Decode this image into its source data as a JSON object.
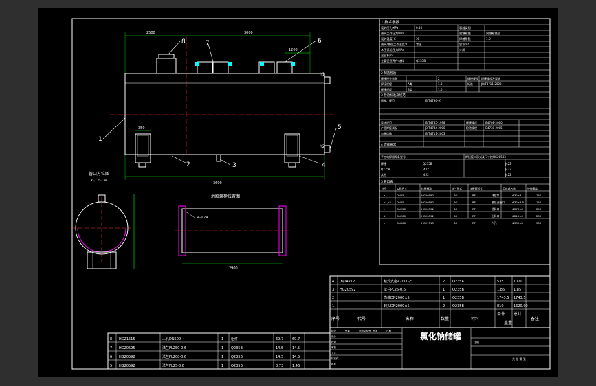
{
  "drawing": {
    "title": "氯化钠储罐",
    "views": {
      "nozzle_orientation_title": "管口方位图",
      "nozzle_orientation_sub": "c、d、e",
      "base_layout_title": "地脚螺栓位置图"
    },
    "dimensions": {
      "top_left": "2500",
      "top_mid": "3000",
      "top_right": "1200",
      "overall": "3600",
      "support_left": "350",
      "base_length": "2900",
      "base_note": "4-Φ24"
    },
    "balloons": [
      "1",
      "2",
      "3",
      "4",
      "5",
      "6",
      "7",
      "8"
    ],
    "level_marks": [
      "h1",
      "h2"
    ],
    "parts_table": {
      "header": [
        "序号",
        "代号",
        "名称",
        "数量",
        "材料",
        "单件",
        "总计",
        "重量",
        "备注"
      ],
      "rows": [
        {
          "no": "4",
          "code": "JB/T4712",
          "name": "鞍式支座A2000-F",
          "qty": "2",
          "mat": "Q235A",
          "w1": "535",
          "w2": "1070"
        },
        {
          "no": "3",
          "code": "HG20592",
          "name": "法兰PL25-0.6",
          "qty": "1",
          "mat": "Q235B",
          "w1": "1.85",
          "w2": "1.85"
        },
        {
          "no": "2",
          "code": "",
          "name": "筒体DN2000×5",
          "qty": "1",
          "mat": "Q235B",
          "w1": "1743.5",
          "w2": "1743.5"
        },
        {
          "no": "1",
          "code": "",
          "name": "封头DN2000×5",
          "qty": "2",
          "mat": "Q235B",
          "w1": "810",
          "w2": "1620.00"
        }
      ]
    },
    "parts_table_lower": [
      {
        "no": "8",
        "code": "HG21515",
        "name": "人孔DN500",
        "qty": "1",
        "mat": "组件",
        "w1": "69.7",
        "w2": "69.7"
      },
      {
        "no": "7",
        "code": "HG20595",
        "name": "法兰PL250-0.6",
        "qty": "1",
        "mat": "Q235B",
        "w1": "14.5",
        "w2": "14.5"
      },
      {
        "no": "6",
        "code": "HG20592",
        "name": "法兰PL200-0.6",
        "qty": "1",
        "mat": "Q235B",
        "w1": "14.5",
        "w2": "14.5"
      },
      {
        "no": "5",
        "code": "HG20592",
        "name": "法兰PL25-0.6",
        "qty": "1",
        "mat": "Q235B",
        "w1": "0.73",
        "w2": "1.46"
      }
    ],
    "spec_table": {
      "section1": "1 技术参数",
      "rows": [
        [
          "设计压力MPa",
          "0.40",
          "容器类别",
          ""
        ],
        [
          "最高工作压力MPa",
          "",
          "腐蚀裕量",
          "腐蚀裕量值"
        ],
        [
          "设计温度°C",
          "50",
          "焊缝系数",
          "1.0"
        ],
        [
          "最高/最低工作温度°C",
          "常温",
          "容积m³",
          ""
        ],
        [
          "水压试验压力MPa",
          "",
          "介质",
          ""
        ],
        [
          "全容积m³",
          "",
          "",
          ""
        ],
        [
          "主要受压元件材料",
          "Q235B",
          "",
          ""
        ]
      ],
      "section2": "2 制造检验",
      "inspect": [
        [
          "焊接接头系数",
          "",
          "2",
          "",
          "焊接规程",
          "焊接规程及要求"
        ],
        [
          "焊接规程",
          "A类",
          "1.0",
          "",
          "标准",
          "JB/T4711-2003"
        ],
        [
          "焊接规程",
          "B类",
          "1.0",
          "",
          "",
          ""
        ]
      ],
      "section3": "3 检验标准及规范",
      "codes": [
        [
          "标准、规范",
          "JB/T4736-97"
        ],
        [
          "设计规范",
          "JB/T4735-1998",
          "焊接规程",
          "JB4708-2000"
        ],
        [
          "产品焊接试板",
          "JB/T4744-2000",
          "检验规程",
          "JB4730-2005"
        ],
        [
          "包装运输",
          "JB/T4711-2003",
          "",
          ""
        ]
      ],
      "section4": "4 焊接要求",
      "welding": [
        [
          "手工电焊用焊条型号",
          "焊接接口形式及尺寸按HG20583"
        ],
        [
          "焊接",
          "Q235B",
          "J422"
        ],
        [
          "Q235B",
          "J422",
          "J422"
        ],
        [
          "其他",
          "J422",
          "J422"
        ]
      ],
      "section5": "5 管口表",
      "nozzle_header": [
        "符号",
        "公称尺寸",
        "连接标准",
        "法兰形式",
        "连接面形式",
        "用途或名称",
        "外伸高度"
      ],
      "nozzles": [
        [
          "a",
          "DN25",
          "HG20592",
          "SO",
          "RF",
          "排空口",
          "Φ32×3",
          "150"
        ],
        [
          "b1,b2",
          "DN25",
          "HG20592",
          "SO",
          "RF",
          "液位计接口",
          "Φ32×3.5",
          "150"
        ],
        [
          "c",
          "DN250",
          "HG20592",
          "SO",
          "RF",
          "进料口",
          "Φ273×8",
          "250"
        ],
        [
          "d",
          "DN200",
          "HG20592",
          "SO",
          "RF",
          "出料口",
          "Φ219×6",
          "250"
        ],
        [
          "e",
          "DN500",
          "HG21515",
          "SO",
          "RF",
          "人孔",
          "Φ530×8",
          "300"
        ]
      ]
    },
    "title_block": {
      "cells": [
        "标记",
        "处数",
        "更改文件号",
        "签字",
        "日期",
        "设计",
        "校对",
        "审核",
        "工艺",
        "标准化",
        "批准"
      ],
      "scale_label": "比例",
      "sheet_label": "共 张 第 张"
    }
  },
  "colors": {
    "frame": "#ffffff",
    "text": "#ffffff",
    "dim": "#00ff00",
    "hidden": "#ffff00",
    "center": "#ff3030",
    "section": "#00ffff",
    "hatch": "#ff00ff"
  }
}
